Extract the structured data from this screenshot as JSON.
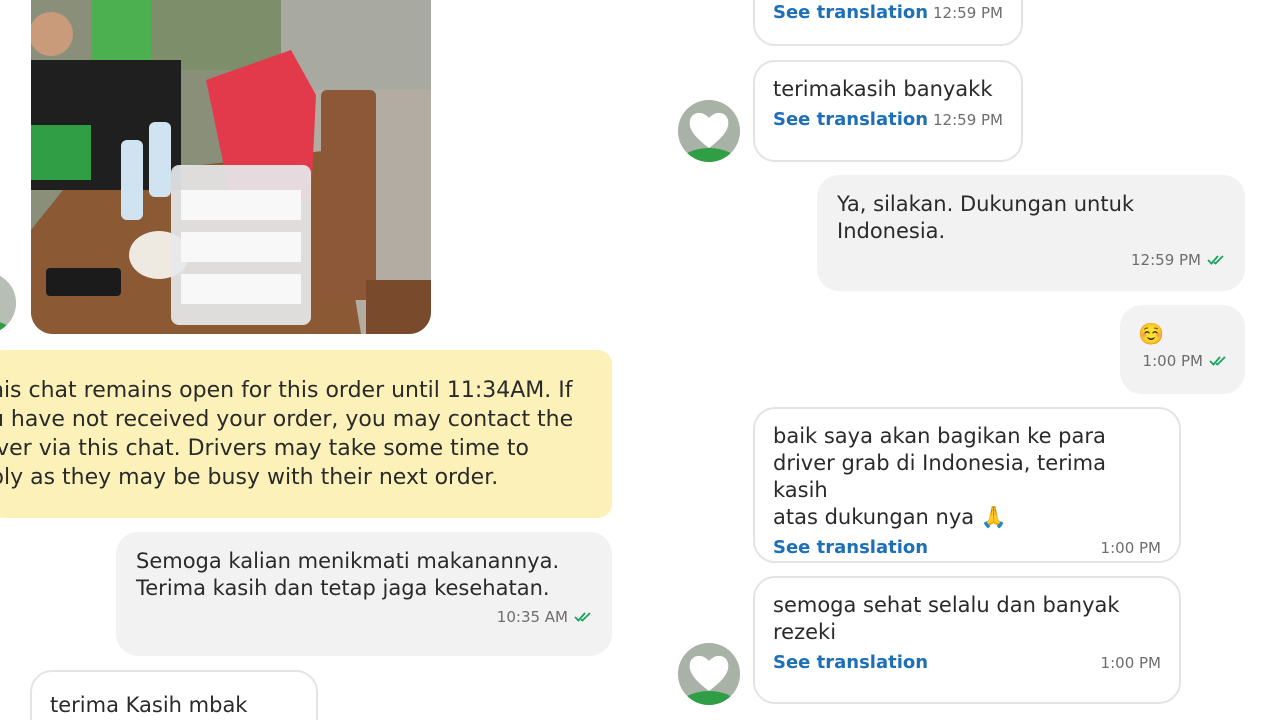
{
  "left_chat": {
    "notice_lines": [
      "his chat remains open for this order until 11:34AM. If",
      "u have not received your order, you may contact the",
      "iver via this chat. Drivers may take some time to",
      "ply as they may be busy with their next order."
    ],
    "outgoing_message": {
      "text": "Semoga kalian menikmati makanannya.\nTerima kasih dan tetap jaga kesehatan.",
      "time": "10:35 AM"
    },
    "incoming_message": {
      "text": "terima Kasih mbak"
    }
  },
  "right_chat": {
    "messages": [
      {
        "text": "",
        "translation": "See translation",
        "time": "12:59 PM"
      },
      {
        "text": "terimakasih banyakk",
        "translation": "See translation",
        "time": "12:59 PM"
      },
      {
        "text": "Ya, silakan. Dukungan untuk\nIndonesia.",
        "time": "12:59 PM"
      },
      {
        "text": "☺️",
        "time": "1:00 PM"
      },
      {
        "text": "baik saya akan bagikan ke para\ndriver grab di Indonesia, terima kasih\natas dukungan nya 🙏",
        "translation": "See translation",
        "time": "1:00 PM"
      },
      {
        "text": "semoga sehat selalu dan banyak\nrezeki",
        "translation": "See translation",
        "time": "1:00 PM"
      }
    ]
  },
  "colors": {
    "link": "#1d6fb8",
    "notice_bg": "#fcf2b9",
    "tick": "#1aa260",
    "outgoing_bg": "#f2f2f2"
  },
  "icons": {
    "read_receipt": "double-check-icon",
    "avatar": "driver-avatar-heart-icon"
  }
}
